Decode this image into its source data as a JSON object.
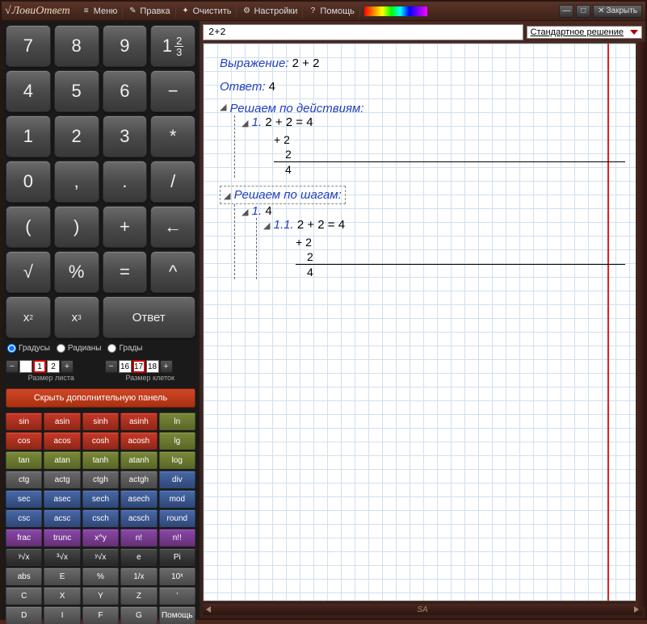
{
  "app": {
    "title": "ЛовиОтвет"
  },
  "menu": {
    "items": [
      {
        "icon": "≡",
        "label": "Меню"
      },
      {
        "icon": "✎",
        "label": "Правка"
      },
      {
        "icon": "✦",
        "label": "Очистить"
      },
      {
        "icon": "⚙",
        "label": "Настройки"
      },
      {
        "icon": "?",
        "label": "Помощь"
      }
    ],
    "close_label": "Закрыть"
  },
  "keypad": {
    "rows": [
      "7",
      "8",
      "9",
      "1⅔",
      "4",
      "5",
      "6",
      "−",
      "1",
      "2",
      "3",
      "*",
      "0",
      ",",
      ".",
      "/",
      "(",
      ")",
      "+",
      "←",
      "√",
      "%",
      "=",
      "↑",
      "x²",
      "x³",
      "Ответ"
    ]
  },
  "anglemode": {
    "opts": [
      "Градусы",
      "Радианы",
      "Грады"
    ],
    "selected": 0
  },
  "steppers": {
    "sheet": {
      "label": "Размер листа",
      "vals": [
        "",
        "1",
        "2"
      ],
      "sel": 1
    },
    "cell": {
      "label": "Размер клеток",
      "vals": [
        "16",
        "17",
        "18"
      ],
      "sel": 1
    }
  },
  "toggle": {
    "label": "Скрыть дополнительную панель"
  },
  "fnkeys": [
    {
      "t": "sin",
      "c": "red"
    },
    {
      "t": "asin",
      "c": "red"
    },
    {
      "t": "sinh",
      "c": "red"
    },
    {
      "t": "asinh",
      "c": "red"
    },
    {
      "t": "ln",
      "c": "grn"
    },
    {
      "t": "cos",
      "c": "red"
    },
    {
      "t": "acos",
      "c": "red"
    },
    {
      "t": "cosh",
      "c": "red"
    },
    {
      "t": "acosh",
      "c": "red"
    },
    {
      "t": "lg",
      "c": "grn"
    },
    {
      "t": "tan",
      "c": "grn"
    },
    {
      "t": "atan",
      "c": "grn"
    },
    {
      "t": "tanh",
      "c": "grn"
    },
    {
      "t": "atanh",
      "c": "grn"
    },
    {
      "t": "log",
      "c": "grn"
    },
    {
      "t": "ctg",
      "c": "gry"
    },
    {
      "t": "actg",
      "c": "gry"
    },
    {
      "t": "ctgh",
      "c": "gry"
    },
    {
      "t": "actgh",
      "c": "gry"
    },
    {
      "t": "div",
      "c": "blu"
    },
    {
      "t": "sec",
      "c": "blu"
    },
    {
      "t": "asec",
      "c": "blu"
    },
    {
      "t": "sech",
      "c": "blu"
    },
    {
      "t": "asech",
      "c": "blu"
    },
    {
      "t": "mod",
      "c": "blu"
    },
    {
      "t": "csc",
      "c": "blu"
    },
    {
      "t": "acsc",
      "c": "blu"
    },
    {
      "t": "csch",
      "c": "blu"
    },
    {
      "t": "acsch",
      "c": "blu"
    },
    {
      "t": "round",
      "c": "blu"
    },
    {
      "t": "frac",
      "c": "pur"
    },
    {
      "t": "trunc",
      "c": "pur"
    },
    {
      "t": "x^y",
      "c": "pur"
    },
    {
      "t": "n!",
      "c": "pur"
    },
    {
      "t": "n!!",
      "c": "pur"
    },
    {
      "t": "ʸ√x",
      "c": "drk"
    },
    {
      "t": "³√x",
      "c": "drk"
    },
    {
      "t": "ʸ√x",
      "c": "drk"
    },
    {
      "t": "e",
      "c": "drk"
    },
    {
      "t": "Pi",
      "c": "drk"
    },
    {
      "t": "abs",
      "c": "gry"
    },
    {
      "t": "E",
      "c": "gry"
    },
    {
      "t": "%",
      "c": "gry"
    },
    {
      "t": "1/x",
      "c": "gry"
    },
    {
      "t": "10ˣ",
      "c": "gry"
    },
    {
      "t": "C",
      "c": "gry"
    },
    {
      "t": "X",
      "c": "gry"
    },
    {
      "t": "Y",
      "c": "gry"
    },
    {
      "t": "Z",
      "c": "gry"
    },
    {
      "t": "'",
      "c": "gry"
    },
    {
      "t": "D",
      "c": "gry"
    },
    {
      "t": "I",
      "c": "gry"
    },
    {
      "t": "F",
      "c": "gry"
    },
    {
      "t": "G",
      "c": "gry"
    },
    {
      "t": "Помощь",
      "c": "gry"
    }
  ],
  "expr": {
    "input": "2+2",
    "mode": "Стандартное решение"
  },
  "solution": {
    "expr_label": "Выражение:",
    "expr": "2 + 2",
    "ans_label": "Ответ:",
    "ans": "4",
    "sec1_title": "Решаем по действиям:",
    "sec1_step": "1.",
    "sec1_eq": "2 + 2 = 4",
    "calc_top": "+ 2",
    "calc_mid": "2",
    "calc_res": "4",
    "sec2_title": "Решаем по шагам:",
    "sec2_s1": "1.",
    "sec2_s1v": "4",
    "sec2_s11": "1.1.",
    "sec2_s11v": "2 + 2 = 4"
  },
  "footer": {
    "brand": "SA"
  }
}
